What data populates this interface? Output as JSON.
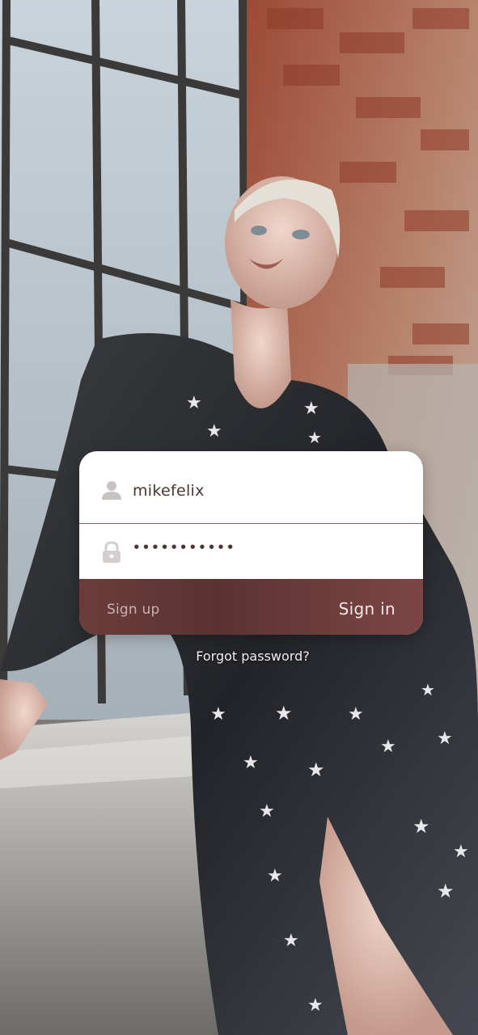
{
  "login": {
    "username_value": "mikefelix",
    "password_masked": "•••••••••••",
    "signup_label": "Sign up",
    "signin_label": "Sign in",
    "forgot_label": "Forgot password?"
  },
  "icons": {
    "user": "user-icon",
    "lock": "lock-icon"
  },
  "colors": {
    "accent": "#6a3d3a",
    "accent_light": "#7d4545",
    "text_dark": "#4a3533",
    "divider": "#8a5e5e"
  }
}
